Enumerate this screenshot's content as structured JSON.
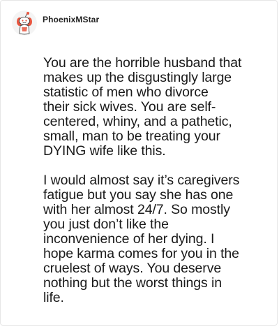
{
  "comment": {
    "username": "PhoenixMStar",
    "avatar_icon": "reddit-snoo-avatar-icon",
    "paragraphs": [
      "You are the horrible husband that\nmakes up the disgustingly large\nstatistic of men who divorce\ntheir sick wives. You are self-\ncentered, whiny, and a pathetic,\nsmall, man to be treating your\nDYING wife like this.",
      "I would almost say it’s caregivers\nfatigue but you say she has one\nwith her almost 24/7. So mostly\nyou just don’t like the\ninconvenience of her dying. I\nhope karma comes for you in the\ncruelest of ways. You deserve\nnothing but the worst things in\nlife."
    ]
  },
  "colors": {
    "border": "#e6e6e6",
    "text": "#1a1a1a",
    "avatar_accent": "#e8553f"
  }
}
